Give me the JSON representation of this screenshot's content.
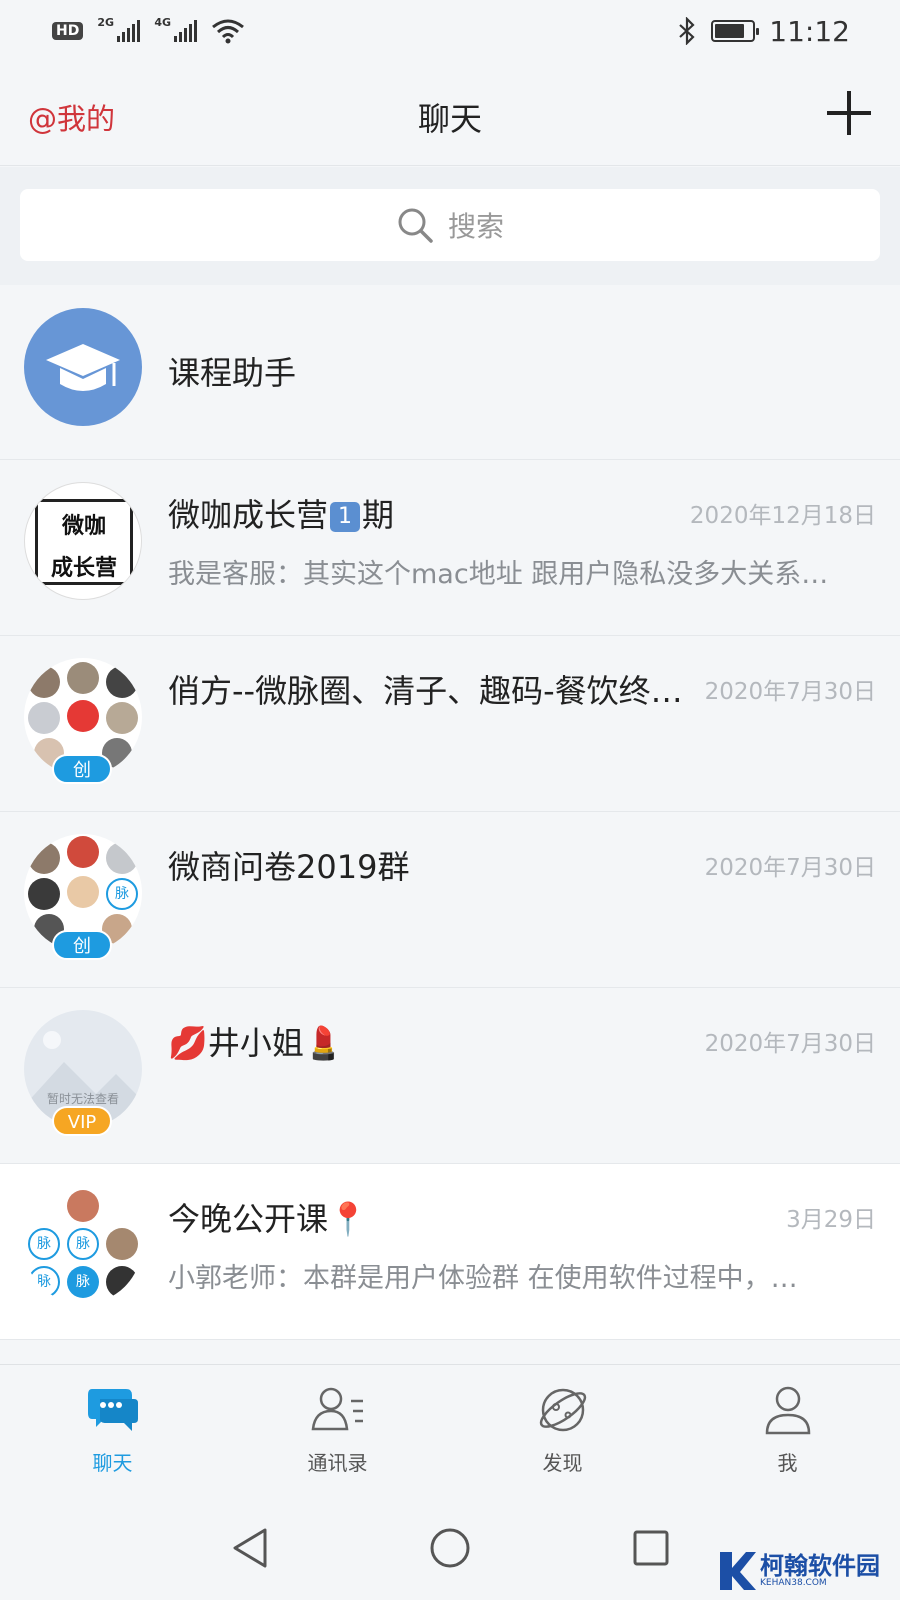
{
  "status_bar": {
    "hd": "HD",
    "sim1_label": "2G",
    "sim2_label": "4G",
    "time": "11:12",
    "battery_level": 0.8
  },
  "header": {
    "mine_label": "@我的",
    "title": "聊天",
    "add_icon": "plus-icon"
  },
  "search": {
    "placeholder": "搜索",
    "icon": "search-icon"
  },
  "chats": [
    {
      "name": "课程助手",
      "time": "",
      "message": ""
    },
    {
      "name_prefix": "微咖成长营",
      "name_num": "1",
      "name_suffix": "期",
      "time": "2020年12月18日",
      "message": "我是客服：其实这个mac地址 跟用户隐私没多大关系…",
      "avatar_line1": "微咖",
      "avatar_line2": "成长营"
    },
    {
      "name": "俏方--微脉圈、清子、趣码-餐饮终…",
      "time": "2020年7月30日",
      "message": "",
      "badge": "创"
    },
    {
      "name": "微商问卷2019群",
      "time": "2020年7月30日",
      "message": "",
      "badge": "创",
      "avatar_mini": "脉"
    },
    {
      "name": "💋井小姐💄",
      "time": "2020年7月30日",
      "message": "",
      "badge": "VIP",
      "avatar_caption": "暂时无法查看"
    },
    {
      "name": "今晚公开课📍",
      "time": "3月29日",
      "message": "小郭老师：本群是用户体验群 在使用软件过程中，…",
      "avatar_mini": "脉"
    }
  ],
  "bottom_nav": [
    {
      "label": "聊天",
      "icon": "chat-bubble-icon",
      "active": true
    },
    {
      "label": "通讯录",
      "icon": "contacts-icon",
      "active": false
    },
    {
      "label": "发现",
      "icon": "discover-icon",
      "active": false
    },
    {
      "label": "我",
      "icon": "profile-icon",
      "active": false
    }
  ],
  "watermark": {
    "logo_letter": "K",
    "text": "柯翰软件园",
    "sub": "KEHAN38.COM"
  },
  "colors": {
    "accent_blue": "#1e9be0",
    "mine_red": "#d0353b",
    "vip_orange": "#f6a623"
  }
}
